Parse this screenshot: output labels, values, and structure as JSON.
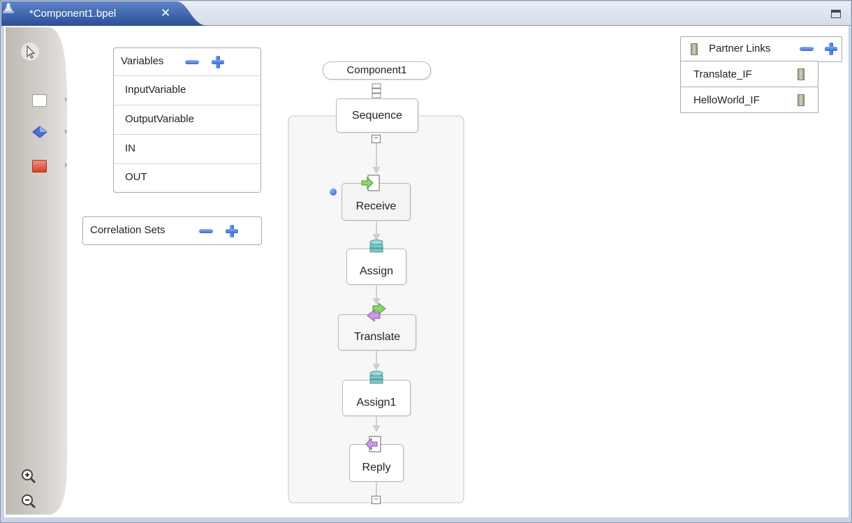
{
  "tab": {
    "title": "*Component1.bpel",
    "close": "✕"
  },
  "palette": {
    "items": [
      {
        "name": "select-tool",
        "icon": "pointer-arrow-icon"
      },
      {
        "name": "empty-activity",
        "icon": "white-box-icon"
      },
      {
        "name": "structured-activity",
        "icon": "blue-diamond-icon"
      },
      {
        "name": "fault-activity",
        "icon": "red-box-icon"
      },
      {
        "name": "zoom-in",
        "icon": "zoom-in-icon"
      },
      {
        "name": "zoom-out",
        "icon": "zoom-out-icon"
      }
    ],
    "chevron": "›"
  },
  "variables": {
    "title": "Variables",
    "items": [
      "InputVariable",
      "OutputVariable",
      "IN",
      "OUT"
    ]
  },
  "correlation_sets": {
    "title": "Correlation Sets"
  },
  "process": {
    "name": "Component1",
    "sequence": "Sequence",
    "activities": [
      "Receive",
      "Assign",
      "Translate",
      "Assign1",
      "Reply"
    ],
    "collapse": "−"
  },
  "partner_links": {
    "title": "Partner Links",
    "items": [
      "Translate_IF",
      "HelloWorld_IF"
    ]
  },
  "colors": {
    "tab_blue": "#2f5aa5",
    "canvas": "#ffffff",
    "frame": "#c9d3e2",
    "accent_blue": "#3c6bd1"
  }
}
